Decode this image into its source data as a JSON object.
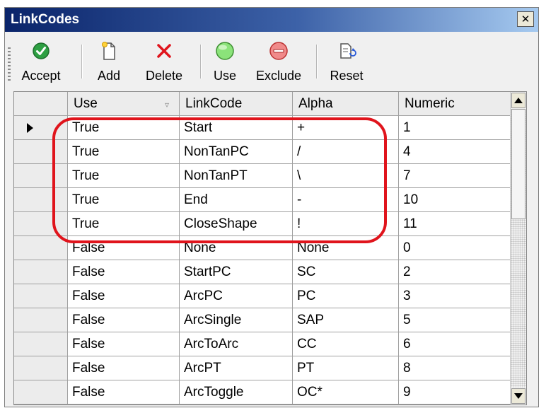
{
  "window": {
    "title": "LinkCodes",
    "close_glyph": "✕"
  },
  "toolbar": {
    "buttons": [
      {
        "label": "Accept",
        "icon": "green-check-icon"
      },
      {
        "label": "Add",
        "icon": "new-page-icon"
      },
      {
        "label": "Delete",
        "icon": "red-x-icon"
      },
      {
        "label": "Use",
        "icon": "green-circle-icon"
      },
      {
        "label": "Exclude",
        "icon": "red-minus-circle-icon"
      },
      {
        "label": "Reset",
        "icon": "reset-page-icon"
      }
    ]
  },
  "grid": {
    "columns": [
      "Use",
      "LinkCode",
      "Alpha",
      "Numeric"
    ],
    "rows": [
      [
        "True",
        "Start",
        "+",
        "1"
      ],
      [
        "True",
        "NonTanPC",
        "/",
        "4"
      ],
      [
        "True",
        "NonTanPT",
        "\\",
        "7"
      ],
      [
        "True",
        "End",
        "-",
        "10"
      ],
      [
        "True",
        "CloseShape",
        "!",
        "11"
      ],
      [
        "False",
        "None",
        "None",
        "0"
      ],
      [
        "False",
        "StartPC",
        "SC",
        "2"
      ],
      [
        "False",
        "ArcPC",
        "PC",
        "3"
      ],
      [
        "False",
        "ArcSingle",
        "SAP",
        "5"
      ],
      [
        "False",
        "ArcToArc",
        "CC",
        "6"
      ],
      [
        "False",
        "ArcPT",
        "PT",
        "8"
      ],
      [
        "False",
        "ArcToggle",
        "OC*",
        "9"
      ]
    ]
  },
  "colors": {
    "title_bar": "#0a246a",
    "highlight": "#e0141c",
    "accept_green": "#2ea043",
    "use_green": "#8be37a",
    "exclude_red": "#e06a6a"
  }
}
